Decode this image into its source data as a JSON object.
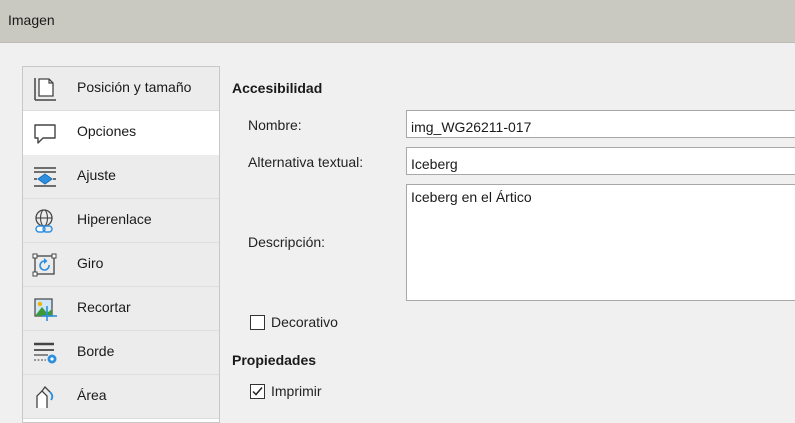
{
  "window": {
    "title": "Imagen"
  },
  "sidebar": {
    "items": [
      {
        "label": "Posición y tamaño",
        "icon": "position-size-icon"
      },
      {
        "label": "Opciones",
        "icon": "speech-bubble-icon"
      },
      {
        "label": "Ajuste",
        "icon": "wrap-icon"
      },
      {
        "label": "Hiperenlace",
        "icon": "globe-link-icon"
      },
      {
        "label": "Giro",
        "icon": "rotate-icon"
      },
      {
        "label": "Recortar",
        "icon": "crop-image-icon"
      },
      {
        "label": "Borde",
        "icon": "border-lines-icon"
      },
      {
        "label": "Área",
        "icon": "area-fill-icon"
      }
    ],
    "selected": "Opciones"
  },
  "accessibility": {
    "heading": "Accesibilidad",
    "name_label": "Nombre:",
    "name_value": "img_WG26211-017",
    "alt_label": "Alternativa textual:",
    "alt_value": "Iceberg",
    "desc_label": "Descripción:",
    "desc_value": "Iceberg en el Ártico",
    "decorative_label": "Decorativo",
    "decorative_checked": false
  },
  "properties": {
    "heading": "Propiedades",
    "print_label": "Imprimir",
    "print_checked": true
  }
}
